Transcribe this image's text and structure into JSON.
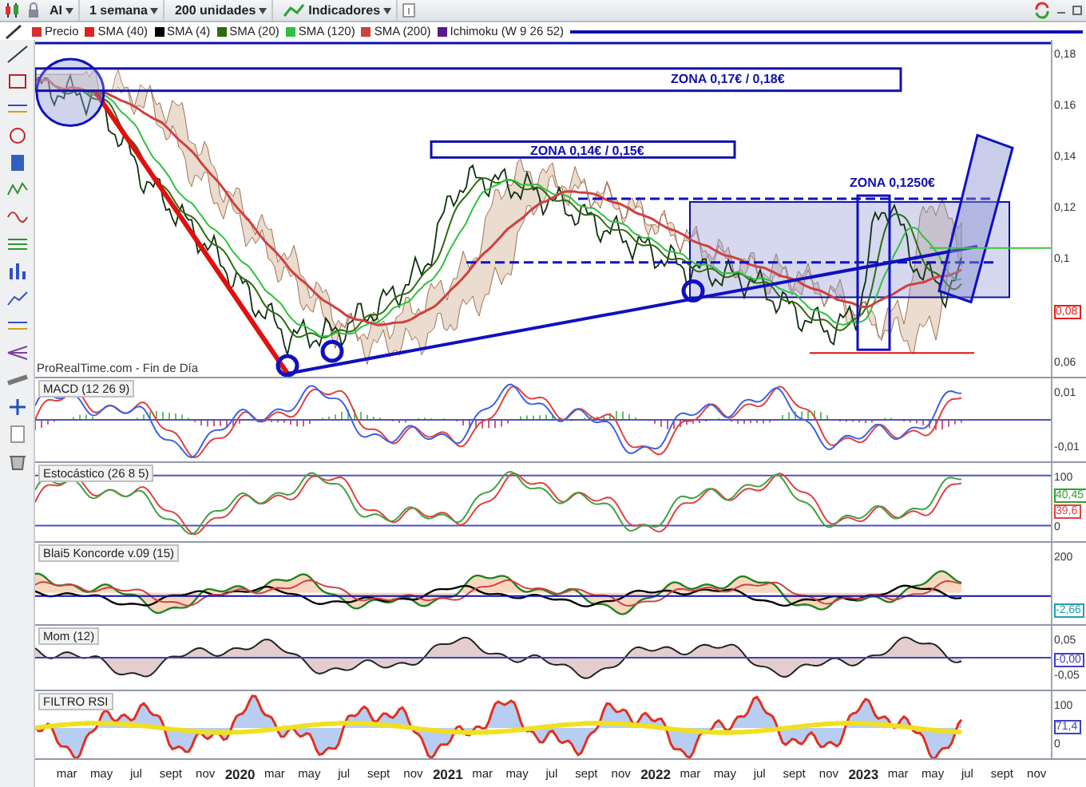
{
  "toolbar": {
    "symbol": "AI",
    "period": "1 semana",
    "units": "200 unidades",
    "indicators": "Indicadores"
  },
  "legend": [
    {
      "label": "Precio",
      "color": "#d83030"
    },
    {
      "label": "SMA (40)",
      "color": "#e02020"
    },
    {
      "label": "SMA (4)",
      "color": "#000000"
    },
    {
      "label": "SMA (20)",
      "color": "#2e6b10"
    },
    {
      "label": "SMA (120)",
      "color": "#30c040"
    },
    {
      "label": "SMA (200)",
      "color": "#d04040"
    },
    {
      "label": "Ichimoku (W 9 26 52)",
      "color": "#5a1a8a"
    }
  ],
  "price_panel": {
    "zones": [
      "ZONA 0,17€ / 0,18€",
      "ZONA 0,14€ / 0,15€",
      "ZONA 0,1250€"
    ],
    "source_note": "ProRealTime.com - Fin de Día",
    "ticks": [
      {
        "text": "0,18",
        "kind": "tick"
      },
      {
        "text": "0,16",
        "kind": "tick"
      },
      {
        "text": "0,14",
        "kind": "tick"
      },
      {
        "text": "0,12",
        "kind": "tick"
      },
      {
        "text": "0,1",
        "kind": "tick"
      },
      {
        "text": "0,08",
        "kind": "tag",
        "color": "#e02020"
      },
      {
        "text": "0,06",
        "kind": "tick"
      }
    ]
  },
  "indicator_panels": [
    {
      "kind": "macd",
      "label": "MACD (12 26 9)",
      "ticks": [
        {
          "text": "0,01",
          "kind": "tick"
        },
        {
          "text": "-0,01",
          "kind": "tick"
        }
      ]
    },
    {
      "kind": "stochastic",
      "label": "Estocástico (26 8 5)",
      "ticks": [
        {
          "text": "100",
          "kind": "tick"
        },
        {
          "text": "40,45",
          "kind": "tag",
          "color": "#30a030"
        },
        {
          "text": "39,6",
          "kind": "tag",
          "color": "#e04040"
        },
        {
          "text": "0",
          "kind": "tick"
        }
      ]
    },
    {
      "kind": "koncorde",
      "label": "Blai5 Koncorde v.09 (15)",
      "ticks": [
        {
          "text": "200",
          "kind": "tick"
        },
        {
          "text": "-2,66",
          "kind": "tag",
          "color": "#20a0b0"
        }
      ]
    },
    {
      "kind": "momentum",
      "label": "Mom (12)",
      "ticks": [
        {
          "text": "0,05",
          "kind": "tick"
        },
        {
          "text": "-0,00",
          "kind": "tag",
          "color": "#4040c0"
        },
        {
          "text": "-0,05",
          "kind": "tick"
        }
      ]
    },
    {
      "kind": "rsi",
      "label": "FILTRO RSI",
      "ticks": [
        {
          "text": "100",
          "kind": "tick"
        },
        {
          "text": "71,4",
          "kind": "tag",
          "color": "#4040c0"
        },
        {
          "text": "0",
          "kind": "tick"
        }
      ]
    }
  ],
  "x_axis": [
    {
      "label": "mar",
      "kind": "month"
    },
    {
      "label": "may",
      "kind": "month"
    },
    {
      "label": "jul",
      "kind": "month"
    },
    {
      "label": "sept",
      "kind": "month"
    },
    {
      "label": "nov",
      "kind": "month"
    },
    {
      "label": "2020",
      "kind": "year"
    },
    {
      "label": "mar",
      "kind": "month"
    },
    {
      "label": "may",
      "kind": "month"
    },
    {
      "label": "jul",
      "kind": "month"
    },
    {
      "label": "sept",
      "kind": "month"
    },
    {
      "label": "nov",
      "kind": "month"
    },
    {
      "label": "2021",
      "kind": "year"
    },
    {
      "label": "mar",
      "kind": "month"
    },
    {
      "label": "may",
      "kind": "month"
    },
    {
      "label": "jul",
      "kind": "month"
    },
    {
      "label": "sept",
      "kind": "month"
    },
    {
      "label": "nov",
      "kind": "month"
    },
    {
      "label": "2022",
      "kind": "year"
    },
    {
      "label": "mar",
      "kind": "month"
    },
    {
      "label": "may",
      "kind": "month"
    },
    {
      "label": "jul",
      "kind": "month"
    },
    {
      "label": "sept",
      "kind": "month"
    },
    {
      "label": "nov",
      "kind": "month"
    },
    {
      "label": "2023",
      "kind": "year"
    },
    {
      "label": "mar",
      "kind": "month"
    },
    {
      "label": "may",
      "kind": "month"
    },
    {
      "label": "jul",
      "kind": "month"
    },
    {
      "label": "sept",
      "kind": "month"
    },
    {
      "label": "nov",
      "kind": "month"
    }
  ]
}
